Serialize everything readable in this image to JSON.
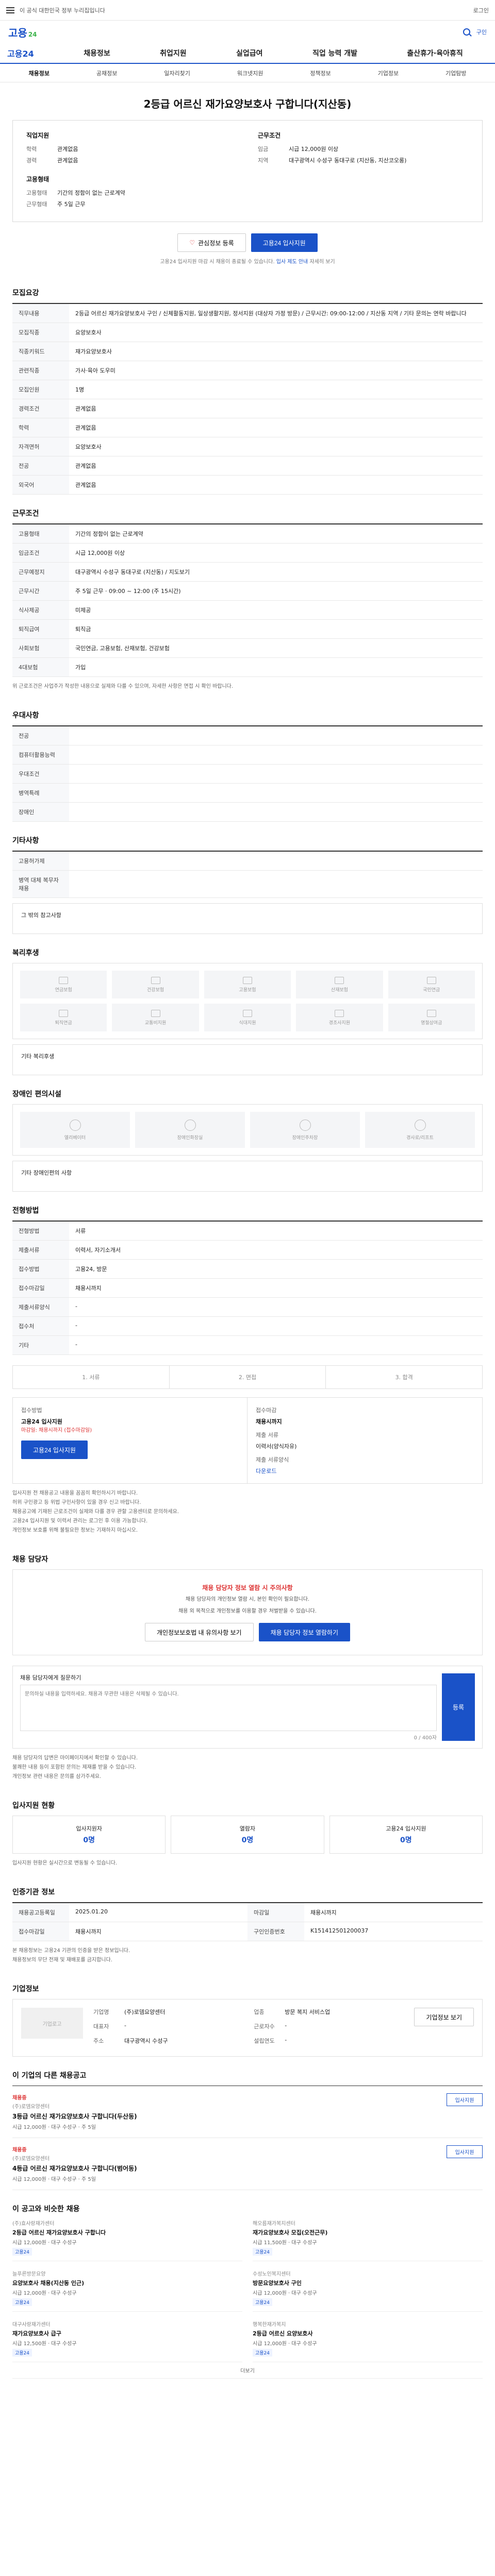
{
  "topbar": {
    "notice": "이 공식 대한민국 정부 누리집입니다",
    "login": "로그인"
  },
  "logo": {
    "name": "고용",
    "sub": "24",
    "mini": "구인"
  },
  "gnb": {
    "brand": "고용24",
    "items": [
      "채용정보",
      "취업지원",
      "실업급여",
      "직업 능력 개발",
      "출산휴가·육아휴직"
    ]
  },
  "subnav": [
    "채용정보",
    "공채정보",
    "일자리찾기",
    "워크넷지원",
    "정책정보",
    "기업정보",
    "기업탐방"
  ],
  "title": "2등급 어르신 재가요양보호사 구합니다(지산동)",
  "summary": {
    "job_group_title": "직업지원",
    "job_rows": [
      {
        "k": "학력",
        "v": "관계없음"
      },
      {
        "k": "경력",
        "v": "관계없음"
      }
    ],
    "cond_group_title": "근무조건",
    "cond_rows": [
      {
        "k": "임금",
        "v": "시급 12,000원 이상"
      },
      {
        "k": "지역",
        "v": "대구광역시 수성구 동대구로 (지산동, 지산코오롱)"
      }
    ],
    "extra_group_title": "고용형태",
    "extra_rows": [
      {
        "k": "고용형태",
        "v": "기간의 정함이 없는 근로계약"
      },
      {
        "k": "근무형태",
        "v": "주 5일 근무"
      }
    ]
  },
  "actions": {
    "bookmark": "관심정보 등록",
    "apply": "고용24 입사지원"
  },
  "apply_note": {
    "pre": "고용24 입사지원 마감 시 채용이 종료될 수 있습니다.",
    "blue": "입사 제도 안내",
    "post": "자세히 보기"
  },
  "sections": {
    "recruit": "모집요강",
    "condition": "근무조건",
    "prefer": "우대사항",
    "other": "기타사항",
    "welfare": "복리후생",
    "disabled": "장애인 편의시설",
    "selection": "전형방법",
    "manager": "채용 담당자",
    "stats": "입사지원 현황",
    "info": "인증기관 정보",
    "company": "기업정보",
    "same_company": "이 기업의 다른 채용공고",
    "recommend": "이 공고와 비슷한 채용"
  },
  "recruit_rows": [
    {
      "th": "직무내용",
      "td": "2등급 어르신 재가요양보호사 구인 / 신체활동지원, 일상생활지원, 정서지원 (대상자 가정 방문) / 근무시간: 09:00-12:00 / 지산동 지역 / 기타 문의는 연락 바랍니다"
    },
    {
      "th": "모집직종",
      "td": "요양보호사"
    },
    {
      "th": "직종키워드",
      "td": "재가요양보호사"
    },
    {
      "th": "관련직종",
      "td": "가사·육아 도우미"
    },
    {
      "th": "모집인원",
      "td": "1명"
    },
    {
      "th": "경력조건",
      "td": "관계없음"
    },
    {
      "th": "학력",
      "td": "관계없음"
    },
    {
      "th": "자격면허",
      "td": "요양보호사"
    },
    {
      "th": "전공",
      "td": "관계없음"
    },
    {
      "th": "외국어",
      "td": "관계없음"
    }
  ],
  "condition_rows": [
    {
      "th": "고용형태",
      "td": "기간의 정함이 없는 근로계약"
    },
    {
      "th": "임금조건",
      "td": "시급 12,000원 이상"
    },
    {
      "th": "근무예정지",
      "td": "대구광역시 수성구 동대구로 (지산동) / 지도보기"
    },
    {
      "th": "근무시간",
      "td": "주 5일 근무 · 09:00 ~ 12:00 (주 15시간)"
    },
    {
      "th": "식사제공",
      "td": "미제공"
    },
    {
      "th": "퇴직급여",
      "td": "퇴직금"
    },
    {
      "th": "사회보험",
      "td": "국민연금, 고용보험, 산재보험, 건강보험"
    },
    {
      "th": "4대보험",
      "td": "가입"
    }
  ],
  "condition_note": "위 근로조건은 사업주가 작성한 내용으로 실제와 다를 수 있으며, 자세한 사항은 면접 시 확인 바랍니다.",
  "prefer_rows": [
    {
      "th": "전공",
      "td": ""
    },
    {
      "th": "컴퓨터활용능력",
      "td": ""
    },
    {
      "th": "우대조건",
      "td": ""
    },
    {
      "th": "병역특례",
      "td": ""
    },
    {
      "th": "장애인",
      "td": ""
    }
  ],
  "other_rows": [
    {
      "th": "고용허가제",
      "td": ""
    },
    {
      "th": "병역 대체 복무자 채용",
      "td": ""
    }
  ],
  "other_note": "그 밖의 참고사항",
  "welfare_items": [
    "연금보험",
    "건강보험",
    "고용보험",
    "산재보험",
    "국민연금",
    "퇴직연금",
    "교통비지원",
    "식대지원",
    "경조사지원",
    "명절상여금"
  ],
  "welfare_note": "기타 복리후생",
  "disabled_items": [
    "엘리베이터",
    "장애인화장실",
    "장애인주차장",
    "경사로/리프트"
  ],
  "disabled_note": "기타 장애인편의 사항",
  "selection_rows": [
    {
      "th": "전형방법",
      "td": "서류"
    },
    {
      "th": "제출서류",
      "td": "이력서, 자기소개서"
    },
    {
      "th": "접수방법",
      "td": "고용24, 방문"
    },
    {
      "th": "접수마감일",
      "td": "채용시까지"
    },
    {
      "th": "제출서류양식",
      "td": "-"
    },
    {
      "th": "접수처",
      "td": "-"
    },
    {
      "th": "기타",
      "td": "-"
    }
  ],
  "method_steps": [
    "1. 서류",
    "2. 면접",
    "3. 합격"
  ],
  "apply_box": {
    "left_label": "접수방법",
    "left_value": "고용24 입사지원",
    "left_red": "마감일: 채용시까지 (접수마감일)",
    "left_btn": "고용24 입사지원",
    "right_label": "접수마감",
    "right_value": "채용시까지",
    "right_label2": "제출 서류",
    "right_value2": "이력서(양식자유)",
    "right_label3": "제출 서류양식",
    "right_value3": "다운로드"
  },
  "apply_bullets": [
    "입사지원 전 채용공고 내용을 꼼꼼히 확인하시기 바랍니다.",
    "허위 구인광고 등 위법 구인사항이 있을 경우 신고 바랍니다.",
    "채용공고에 기재된 근로조건이 실제와 다를 경우 관할 고용센터로 문의하세요.",
    "고용24 입사지원 및 이력서 관리는 로그인 후 이용 가능합니다.",
    "개인정보 보호를 위해 불필요한 정보는 기재하지 마십시오."
  ],
  "manager_box": {
    "warn": "채용 담당자 정보 열람 시 주의사항",
    "desc1": "채용 담당자의 개인정보 열람 시, 본인 확인이 필요합니다.",
    "desc2": "채용 외 목적으로 개인정보를 이용할 경우 처벌받을 수 있습니다.",
    "btn1": "개인정보보호법 내 유의사항 보기",
    "btn2": "채용 담당자 정보 열람하기"
  },
  "inquiry": {
    "label": "채용 담당자에게 질문하기",
    "placeholder": "문의하실 내용을 입력하세요. 채용과 무관한 내용은 삭제될 수 있습니다.",
    "send": "등록",
    "counter": "0 / 400자"
  },
  "inquiry_notes": [
    "채용 담당자의 답변은 마이페이지에서 확인할 수 있습니다.",
    "불쾌한 내용 등이 포함된 문의는 제재를 받을 수 있습니다.",
    "개인정보 관련 내용은 문의를 삼가주세요."
  ],
  "stats": [
    {
      "label": "입사지원자",
      "value": "0명"
    },
    {
      "label": "열람자",
      "value": "0명"
    },
    {
      "label": "고용24 입사지원",
      "value": "0명"
    }
  ],
  "stats_note": "입사지원 현황은 실시간으로 변동될 수 있습니다.",
  "info_rows": [
    {
      "th": "채용공고등록일",
      "td": "2025.01.20"
    },
    {
      "th": "마감일",
      "td": "채용시까지"
    },
    {
      "th": "접수마감일",
      "td": "채용시까지"
    },
    {
      "th": "구인인증번호",
      "td": "K151412501200037"
    }
  ],
  "info_notes": [
    "본 채용정보는 고용24 기관의 인증을 받은 정보입니다.",
    "채용정보의 무단 전재 및 재배포를 금지합니다."
  ],
  "company": {
    "logo_alt": "기업로고",
    "rows": [
      {
        "k": "기업명",
        "v": "(주)로뎀요양센터"
      },
      {
        "k": "업종",
        "v": "방문 복지 서비스업"
      },
      {
        "k": "대표자",
        "v": "-"
      },
      {
        "k": "근로자수",
        "v": "-"
      },
      {
        "k": "주소",
        "v": "대구광역시 수성구"
      },
      {
        "k": "설립연도",
        "v": "-"
      }
    ],
    "btn": "기업정보 보기"
  },
  "same_company_jobs": [
    {
      "tag": "채용중",
      "co": "(주)로뎀요양센터",
      "t": "3등급 어르신 재가요양보호사 구합니다(두산동)",
      "meta": "시급 12,000원 · 대구 수성구 · 주 5일",
      "act": "입사지원"
    },
    {
      "tag": "채용중",
      "co": "(주)로뎀요양센터",
      "t": "4등급 어르신 재가요양보호사 구합니다(범어동)",
      "meta": "시급 12,000원 · 대구 수성구 · 주 5일",
      "act": "입사지원"
    }
  ],
  "recommend": [
    {
      "co": "(주)효사랑재가센터",
      "t": "2등급 어르신 재가요양보호사 구합니다",
      "meta": "시급 12,000원 · 대구 수성구",
      "badge": "고용24"
    },
    {
      "co": "해오름재가복지센터",
      "t": "재가요양보호사 모집(오전근무)",
      "meta": "시급 11,500원 · 대구 수성구",
      "badge": "고용24"
    },
    {
      "co": "늘푸른방문요양",
      "t": "요양보호사 채용(지산동 인근)",
      "meta": "시급 12,000원 · 대구 수성구",
      "badge": "고용24"
    },
    {
      "co": "수성노인복지센터",
      "t": "방문요양보호사 구인",
      "meta": "시급 12,000원 · 대구 수성구",
      "badge": "고용24"
    },
    {
      "co": "대구사랑재가센터",
      "t": "재가요양보호사 급구",
      "meta": "시급 12,500원 · 대구 수성구",
      "badge": "고용24"
    },
    {
      "co": "행복한재가복지",
      "t": "2등급 어르신 요양보호사",
      "meta": "시급 12,000원 · 대구 수성구",
      "badge": "고용24"
    }
  ],
  "more_label": "더보기"
}
